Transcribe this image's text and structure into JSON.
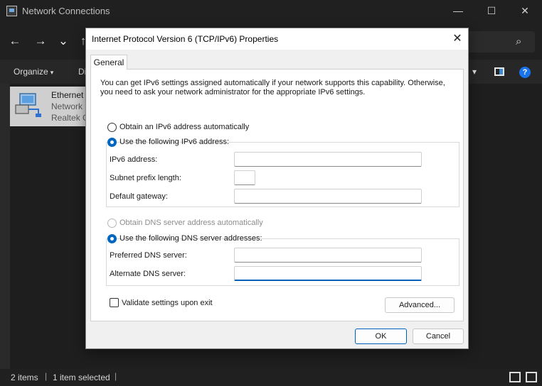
{
  "explorer": {
    "title": "Network Connections",
    "window_controls": {
      "minimize": "—",
      "maximize": "☐",
      "close": "✕"
    },
    "nav": {
      "back": "←",
      "forward": "→",
      "recent": "⌄",
      "up": "↑"
    },
    "search_icon": "⌕",
    "commandbar": {
      "organize": "Organize",
      "organize_caret": "▾",
      "partial_item": "Di",
      "options_caret": "▾",
      "help": "?"
    },
    "item": {
      "name": "Ethernet",
      "line2": "Network",
      "line3": "Realtek G"
    },
    "status": {
      "count": "2 items",
      "selected": "1 item selected",
      "sep": "|"
    }
  },
  "dialog": {
    "title": "Internet Protocol Version 6 (TCP/IPv6) Properties",
    "close": "✕",
    "tab": "General",
    "intro": "You can get IPv6 settings assigned automatically if your network supports this capability. Otherwise, you need to ask your network administrator for the appropriate IPv6 settings.",
    "ip": {
      "auto_label": "Obtain an IPv6 address automatically",
      "manual_label": "Use the following IPv6 address:",
      "auto_selected": false,
      "manual_selected": true,
      "fields": [
        {
          "label": "IPv6 address:",
          "value": ""
        },
        {
          "label": "Subnet prefix length:",
          "value": ""
        },
        {
          "label": "Default gateway:",
          "value": ""
        }
      ]
    },
    "dns": {
      "auto_label": "Obtain DNS server address automatically",
      "manual_label": "Use the following DNS server addresses:",
      "auto_enabled": false,
      "manual_selected": true,
      "fields": [
        {
          "label": "Preferred DNS server:",
          "value": ""
        },
        {
          "label": "Alternate DNS server:",
          "value": ""
        }
      ]
    },
    "validate_label": "Validate settings upon exit",
    "validate_checked": false,
    "advanced_button": "Advanced...",
    "ok_button": "OK",
    "cancel_button": "Cancel"
  },
  "colors": {
    "accent": "#0067c0",
    "titlebar_dark": "#202020"
  }
}
